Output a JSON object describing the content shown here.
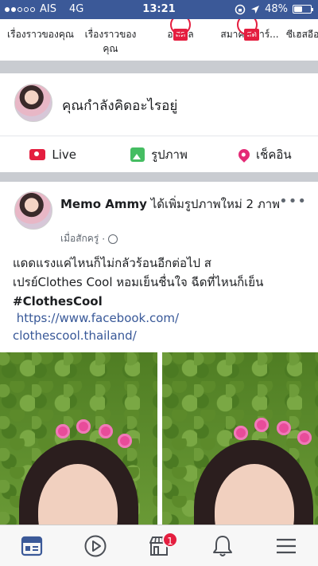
{
  "status_bar": {
    "carrier": "AIS",
    "network": "4G",
    "time": "13:21",
    "battery": "48%",
    "battery_level": 0.48,
    "signal_bars": 2
  },
  "stories": [
    {
      "label": "เรื่องราวของคุณ"
    },
    {
      "label": "เรื่องราวของคุณ"
    },
    {
      "label_prefix": "อ",
      "live": "สด",
      "label_suffix": "ล"
    },
    {
      "label_prefix": "สมาค",
      "live": "สด",
      "label_suffix": "าร์..."
    },
    {
      "label": "ซีเฮสอีอ"
    }
  ],
  "composer": {
    "placeholder": "คุณกำลังคิดอะไรอยู่"
  },
  "composer_actions": [
    {
      "label": "Live",
      "icon": "live-video-icon",
      "color": "#e41e3f"
    },
    {
      "label": "รูปภาพ",
      "icon": "photo-icon",
      "color": "#45bd62"
    },
    {
      "label": "เช็คอิน",
      "icon": "checkin-pin-icon",
      "color": "#e42a76"
    }
  ],
  "post": {
    "author": "Memo Ammy",
    "action_text": "ได้เพิ่มรูปภาพใหม่ 2 ภาพ",
    "timestamp": "เมื่อสักครู่",
    "separator": "·",
    "body_line1": "แดดแรงแค่ไหนก็ไม่กลัวร้อนอีกต่อไป ส",
    "body_line2": "เปรย์Clothes Cool หอมเย็นชื่นใจ ฉีดที่ไหนก็เย็น",
    "hashtag": "#ClothesCool",
    "link_line1": " https://www.facebook.com/",
    "link_line2": "clothescool.thailand/",
    "more": "•••"
  },
  "bottom_nav": {
    "items": [
      "news-feed-icon",
      "watch-icon",
      "marketplace-icon",
      "notifications-icon",
      "menu-icon"
    ],
    "marketplace_badge": "1",
    "accent_color": "#3b5998"
  }
}
